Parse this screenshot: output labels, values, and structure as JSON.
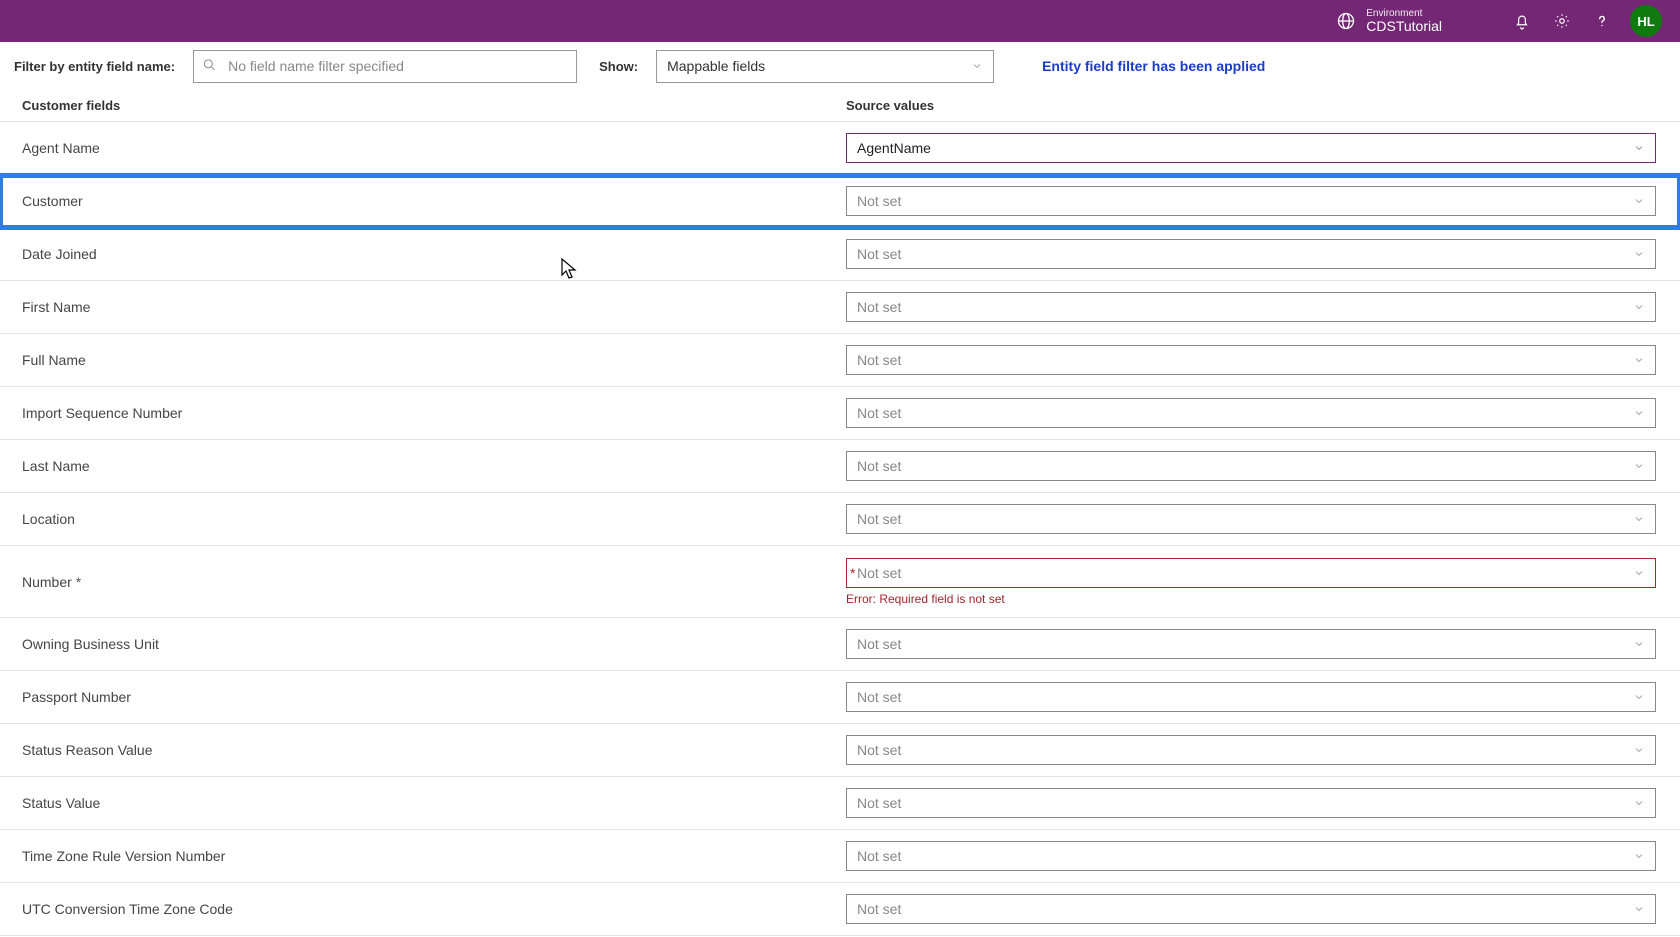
{
  "header": {
    "env_label": "Environment",
    "env_name": "CDSTutorial",
    "avatar_initials": "HL"
  },
  "filterBar": {
    "filter_label": "Filter by entity field name:",
    "filter_placeholder": "No field name filter specified",
    "show_label": "Show:",
    "show_value": "Mappable fields",
    "notice": "Entity field filter has been applied"
  },
  "columns": {
    "left": "Customer fields",
    "right": "Source values"
  },
  "notSet": "Not set",
  "rows": [
    {
      "label": "Agent Name",
      "value": "AgentName",
      "required": false,
      "error": null,
      "highlight": false
    },
    {
      "label": "Customer",
      "value": null,
      "required": false,
      "error": null,
      "highlight": true
    },
    {
      "label": "Date Joined",
      "value": null,
      "required": false,
      "error": null,
      "highlight": false
    },
    {
      "label": "First Name",
      "value": null,
      "required": false,
      "error": null,
      "highlight": false
    },
    {
      "label": "Full Name",
      "value": null,
      "required": false,
      "error": null,
      "highlight": false
    },
    {
      "label": "Import Sequence Number",
      "value": null,
      "required": false,
      "error": null,
      "highlight": false
    },
    {
      "label": "Last Name",
      "value": null,
      "required": false,
      "error": null,
      "highlight": false
    },
    {
      "label": "Location",
      "value": null,
      "required": false,
      "error": null,
      "highlight": false
    },
    {
      "label": "Number",
      "value": null,
      "required": true,
      "error": "Error: Required field is not set",
      "highlight": false
    },
    {
      "label": "Owning Business Unit",
      "value": null,
      "required": false,
      "error": null,
      "highlight": false
    },
    {
      "label": "Passport Number",
      "value": null,
      "required": false,
      "error": null,
      "highlight": false
    },
    {
      "label": "Status Reason Value",
      "value": null,
      "required": false,
      "error": null,
      "highlight": false
    },
    {
      "label": "Status Value",
      "value": null,
      "required": false,
      "error": null,
      "highlight": false
    },
    {
      "label": "Time Zone Rule Version Number",
      "value": null,
      "required": false,
      "error": null,
      "highlight": false
    },
    {
      "label": "UTC Conversion Time Zone Code",
      "value": null,
      "required": false,
      "error": null,
      "highlight": false
    }
  ]
}
